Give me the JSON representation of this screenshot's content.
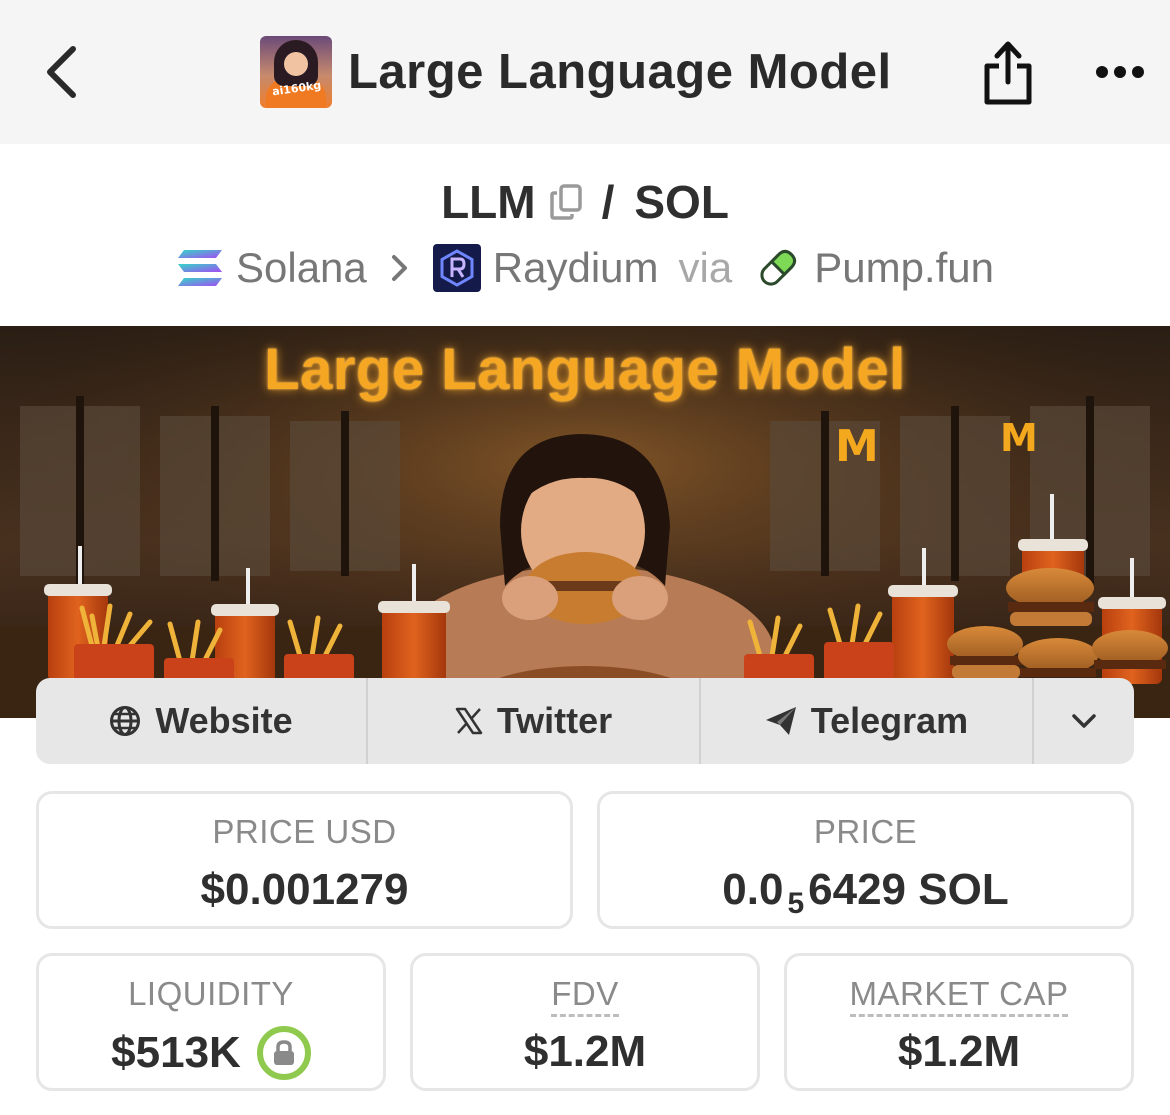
{
  "header": {
    "title": "Large Language Model",
    "avatar_text": "ai160kg",
    "icons": {
      "back": "chevron-left-icon",
      "share": "share-icon",
      "more": "more-horizontal-icon"
    }
  },
  "pair": {
    "base": "LLM",
    "separator": "/",
    "quote": "SOL",
    "chain": "Solana",
    "dex": "Raydium",
    "via_label": "via",
    "launchpad": "Pump.fun"
  },
  "banner": {
    "title": "Large Language Model"
  },
  "socials": [
    {
      "label": "Website",
      "icon": "globe-icon"
    },
    {
      "label": "Twitter",
      "icon": "x-logo-icon"
    },
    {
      "label": "Telegram",
      "icon": "telegram-icon"
    }
  ],
  "stats": {
    "price_usd": {
      "label": "PRICE USD",
      "value": "$0.001279"
    },
    "price_native": {
      "label": "PRICE",
      "value_prefix": "0.0",
      "zero_count": "5",
      "value_suffix": "6429 SOL"
    },
    "liquidity": {
      "label": "LIQUIDITY",
      "value": "$513K",
      "icon": "lock-icon"
    },
    "fdv": {
      "label": "FDV",
      "value": "$1.2M"
    },
    "market_cap": {
      "label": "MARKET CAP",
      "value": "$1.2M"
    }
  },
  "colors": {
    "topbar_bg": "#f5f5f5",
    "socials_bg": "#e7e7e7",
    "lock_ring": "#8fca4e",
    "banner_title": "#f5a623"
  }
}
